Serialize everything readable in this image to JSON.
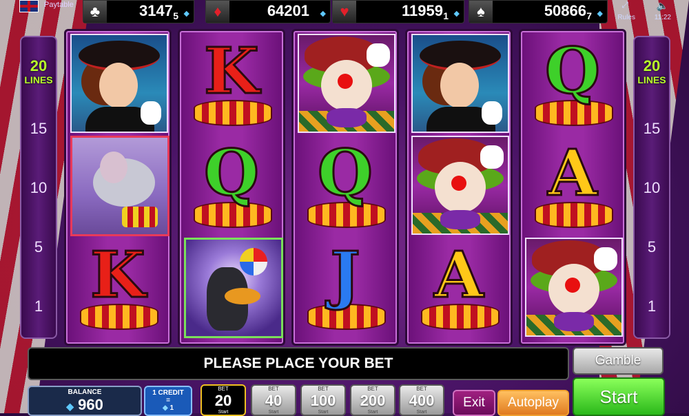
{
  "topbar": {
    "paytable_label": "Paytable",
    "jackpots": [
      {
        "suit": "♣",
        "value": "3147",
        "sub": "5"
      },
      {
        "suit": "♦",
        "value": "64201",
        "sub": ""
      },
      {
        "suit": "♥",
        "value": "11959",
        "sub": "1"
      },
      {
        "suit": "♠",
        "value": "50866",
        "sub": "7"
      }
    ],
    "time": "11:22",
    "help": "Rules"
  },
  "lines": {
    "count": "20",
    "label": "LINES",
    "markers": [
      "15",
      "10",
      "5",
      "1"
    ]
  },
  "reels": [
    [
      "lady",
      "elephant",
      "K"
    ],
    [
      "K",
      "Q",
      "seal"
    ],
    [
      "clown",
      "Q",
      "J"
    ],
    [
      "lady",
      "clown",
      "A"
    ],
    [
      "Q",
      "A",
      "clown"
    ]
  ],
  "message": "PLEASE PLACE YOUR BET",
  "gamble_label": "Gamble",
  "balance": {
    "label": "BALANCE",
    "value": "960"
  },
  "credit": {
    "line1": "1 CREDIT",
    "line2": "=",
    "line3": "1"
  },
  "bets": [
    {
      "label": "BET",
      "value": "20",
      "sub": "Start",
      "selected": true
    },
    {
      "label": "BET",
      "value": "40",
      "sub": "Start",
      "selected": false
    },
    {
      "label": "BET",
      "value": "100",
      "sub": "Start",
      "selected": false
    },
    {
      "label": "BET",
      "value": "200",
      "sub": "Start",
      "selected": false
    },
    {
      "label": "BET",
      "value": "400",
      "sub": "Start",
      "selected": false
    }
  ],
  "exit_label": "Exit",
  "autoplay_label": "Autoplay",
  "start_label": "Start"
}
